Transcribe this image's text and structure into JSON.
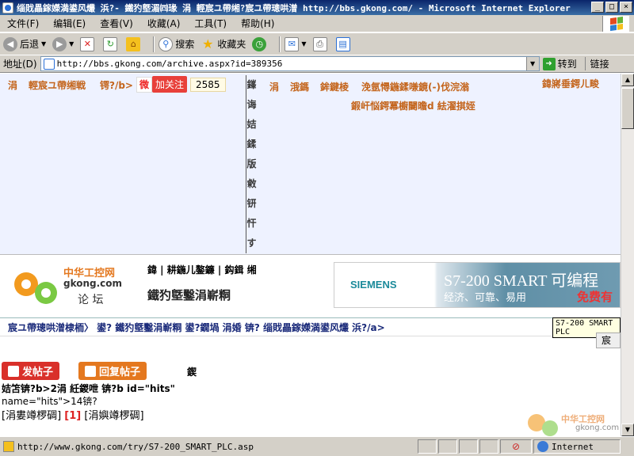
{
  "window": {
    "title": "缁戝畾鎵嬫満鍙风爜   浜?- 鐵犳墍湄㈣瑑  涓   輕宸ユ帶缃?宸ユ帶璁哄潧   http://bbs.gkong.com/ - Microsoft Internet Explorer",
    "min": "_",
    "max": "□",
    "close": "×"
  },
  "menu": [
    "文件(F)",
    "编辑(E)",
    "查看(V)",
    "收藏(A)",
    "工具(T)",
    "帮助(H)"
  ],
  "toolbar": {
    "back": "后退",
    "search": "搜索",
    "favorites": "收藏夹"
  },
  "address": {
    "label": "地址(D)",
    "url": "http://bbs.gkong.com/archive.aspx?id=389356",
    "go": "转到",
    "links": "链接"
  },
  "topnav": {
    "left_items": [
      "涓",
      "輕宸ユ帶缃戦",
      "锷?/b>"
    ],
    "weibo_logo": "微",
    "follow": "加关注",
    "follow_count": "2585",
    "right_row1": [
      "涓",
      "涐鎷",
      "鉾鍵棱",
      "浼氬憳鍦鍒嗛鏡(-)伐浣滃"
    ],
    "right_row2": "鍜屽悩鍔冪櫥闄曕d 紶濯掑姪",
    "far_right": "鍏嶈垂鍔ㄦ畯",
    "vertical": [
      "鎽",
      "诲",
      "姞",
      "鍒",
      "版",
      "敹",
      "钘",
      "忓",
      "す"
    ]
  },
  "header": {
    "logo_cn": "中华工控网",
    "logo_en": "gkong.com",
    "logo_forum": "论 坛",
    "links": "鍏 | 耕鍦儿鏊鐮 | 鈎鍓   缃",
    "forum_title": "鐵犳墍鑿涓嶄粡",
    "banner_brand": "SIEMENS",
    "banner_product": "S7-200 SMART 可编程",
    "banner_tagline": "经济、可靠、易用",
    "banner_free": "免费有"
  },
  "breadcrumb": "宸ユ帶璁哄潧棣栭〉   鍙? 鐵犳墍鑿涓嶄粡  鍙?鐗堝   涓婚   锛? 缁戝畾鎵嬫満鍙风爜      浜?/a>",
  "tooltip": "S7-200 SMART PLC",
  "side_button": "宸",
  "post": {
    "new_post": "发帖子",
    "reply_post": "回复帖子",
    "garbage": "鍥",
    "line1": "姞笘锛?b>2涓   紝鍐呭   锛?b id=\"hits\"",
    "line2": "name=\"hits\">14锛?",
    "line3_a": "[涓婁竴椤碉]",
    "line3_page": "[1]",
    "line3_b": "[涓嬩竴椤碉]"
  },
  "watermark": {
    "cn": "中华工控网",
    "en": "gkong.com"
  },
  "status": {
    "url": "http://www.gkong.com/try/S7-200_SMART_PLC.asp",
    "zone": "Internet"
  },
  "colors": {
    "accent_orange": "#c4651c",
    "siemens_teal": "#1b8a9a",
    "new_post": "#d9302a",
    "reply_post": "#e4781f"
  }
}
